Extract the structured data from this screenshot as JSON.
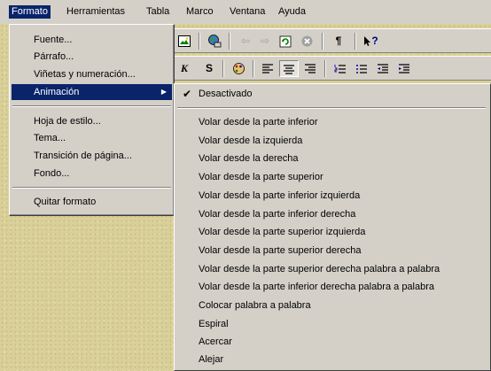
{
  "menubar": {
    "items": [
      {
        "label": "Formato"
      },
      {
        "label": "Herramientas"
      },
      {
        "label": "Tabla"
      },
      {
        "label": "Marco"
      },
      {
        "label": "Ventana"
      },
      {
        "label": "Ayuda"
      }
    ]
  },
  "formato_menu": {
    "items": [
      {
        "label": "Fuente..."
      },
      {
        "label": "Párrafo..."
      },
      {
        "label": "Viñetas y numeración..."
      },
      {
        "label": "Animación"
      },
      {
        "label": "Hoja de estilo..."
      },
      {
        "label": "Tema..."
      },
      {
        "label": "Transición de página..."
      },
      {
        "label": "Fondo..."
      },
      {
        "label": "Quitar formato"
      }
    ]
  },
  "animacion_submenu": {
    "checked": {
      "label": "Desactivado"
    },
    "items": [
      {
        "label": "Volar desde la parte inferior"
      },
      {
        "label": "Volar desde la izquierda"
      },
      {
        "label": "Volar desde la derecha"
      },
      {
        "label": "Volar desde la parte superior"
      },
      {
        "label": "Volar desde la parte inferior izquierda"
      },
      {
        "label": "Volar desde la parte inferior derecha"
      },
      {
        "label": "Volar desde la parte superior izquierda"
      },
      {
        "label": "Volar desde la parte superior derecha"
      },
      {
        "label": "Volar desde la parte superior derecha palabra a palabra"
      },
      {
        "label": "Volar desde la parte inferior derecha palabra a palabra"
      },
      {
        "label": "Colocar palabra a palabra"
      },
      {
        "label": "Espiral"
      },
      {
        "label": "Acercar"
      },
      {
        "label": "Alejar"
      }
    ]
  },
  "toolbar": {
    "bold_label": "K",
    "strike_label": "S",
    "pilcrow_label": "¶",
    "help_label": "?"
  },
  "colors": {
    "menu_bg": "#d4d0c8",
    "highlight": "#0a246a",
    "document_bg": "#d9cf98"
  }
}
